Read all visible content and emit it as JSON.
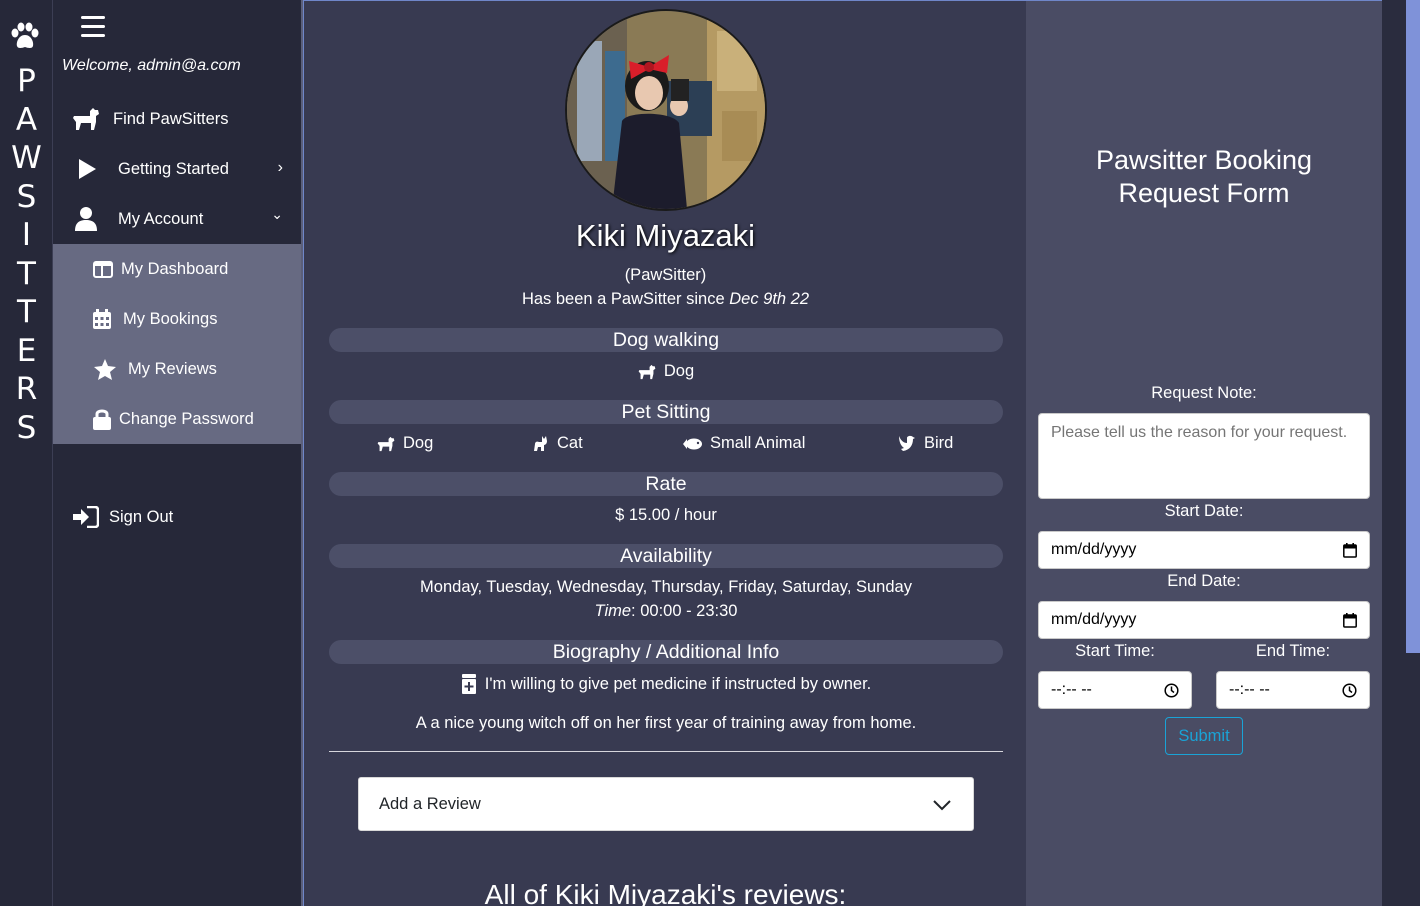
{
  "brand": {
    "letters": [
      "P",
      "A",
      "W",
      "S",
      "I",
      "T",
      "T",
      "E",
      "R",
      "S"
    ]
  },
  "sidebar": {
    "welcome": "Welcome, admin@a.com",
    "items": [
      {
        "label": "Find PawSitters",
        "icon": "dog-icon"
      },
      {
        "label": "Getting Started",
        "icon": "play-icon",
        "caret": "›"
      },
      {
        "label": "My Account",
        "icon": "user-icon",
        "caret": "⌄"
      }
    ],
    "submenu": [
      {
        "label": "My Dashboard",
        "icon": "dashboard-icon"
      },
      {
        "label": "My Bookings",
        "icon": "calendar-icon"
      },
      {
        "label": "My Reviews",
        "icon": "star-icon"
      },
      {
        "label": "Change Password",
        "icon": "lock-icon"
      }
    ],
    "signout": "Sign Out"
  },
  "profile": {
    "name": "Kiki Miyazaki",
    "role": "(PawSitter)",
    "since_prefix": "Has been a PawSitter since ",
    "since_date": "Dec 9th 22",
    "sections": {
      "dog_walking": "Dog walking",
      "pet_sitting": "Pet Sitting",
      "rate": "Rate",
      "availability": "Availability",
      "bio": "Biography / Additional Info"
    },
    "dog_walking_pets": [
      "Dog"
    ],
    "pet_sitting_pets": [
      "Dog",
      "Cat",
      "Small Animal",
      "Bird"
    ],
    "rate_text": "$ 15.00 / hour",
    "days": "Monday, Tuesday, Wednesday, Thursday, Friday, Saturday, Sunday",
    "time_label": "Time",
    "time_value": ": 00:00 - 23:30",
    "medicine_note": "I'm willing to give pet medicine if instructed by owner.",
    "bio_text": "A a nice young witch off on her first year of training away from home.",
    "add_review": "Add a Review",
    "reviews_title": "All of Kiki Miyazaki's reviews:"
  },
  "form": {
    "title_line1": "Pawsitter Booking",
    "title_line2": "Request Form",
    "note_label": "Request Note:",
    "note_placeholder": "Please tell us the reason for your request.",
    "start_date_label": "Start Date:",
    "start_date_value": "mm/dd/yyyy",
    "end_date_label": "End Date:",
    "end_date_value": "mm/dd/yyyy",
    "start_time_label": "Start Time:",
    "start_time_value": "--:-- --",
    "end_time_label": "End Time:",
    "end_time_value": "--:-- --",
    "submit": "Submit"
  },
  "colors": {
    "sidebar_bg": "#262839",
    "main_bg": "#383a51",
    "form_bg": "#4a4c64",
    "submenu_bg": "#676a82",
    "accent": "#1aa3d6"
  }
}
